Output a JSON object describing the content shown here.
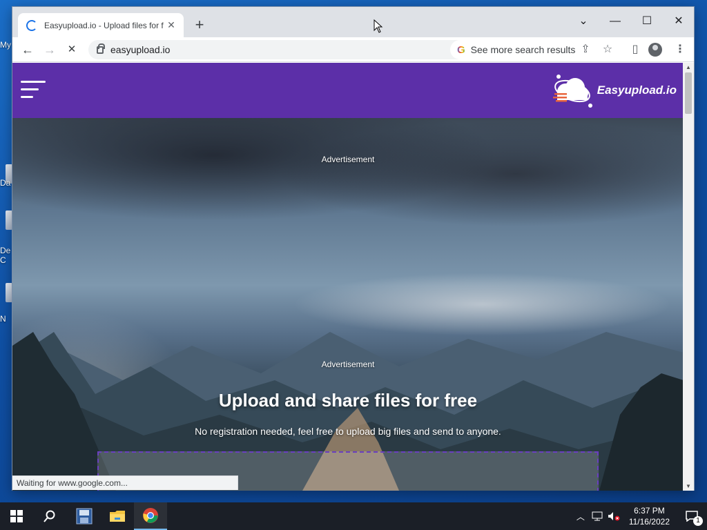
{
  "desktop": {
    "icon_labels": [
      "My",
      "Da",
      "De C",
      "N"
    ]
  },
  "browser": {
    "tab": {
      "title": "Easyupload.io - Upload files for f"
    },
    "window_controls": {
      "dropdown": "⌄",
      "minimize": "—",
      "maximize": "☐",
      "close": "✕"
    },
    "toolbar": {
      "back_glyph": "←",
      "forward_glyph": "→",
      "stop_glyph": "✕",
      "url": "easyupload.io",
      "search_chip_g": "G",
      "search_chip_label": "See more search results",
      "icons": [
        "share-icon",
        "bookmark-star-icon",
        "side-panel-icon",
        "profile-icon",
        "menu-kebab-icon"
      ]
    },
    "status_text": "Waiting for www.google.com..."
  },
  "page": {
    "header": {
      "logo_text": "Easyupload.io",
      "brand_color": "#5c2fa8"
    },
    "ad_label_top": "Advertisement",
    "ad_label_mid": "Advertisement",
    "hero_title": "Upload and share files for free",
    "hero_subtitle": "No registration needed, feel free to upload big files and send to anyone."
  },
  "taskbar": {
    "apps": [
      "start-icon",
      "search-icon",
      "app-icon",
      "file-explorer-icon",
      "chrome-icon"
    ],
    "time": "6:37 PM",
    "date": "11/16/2022",
    "notification_count": "1"
  }
}
